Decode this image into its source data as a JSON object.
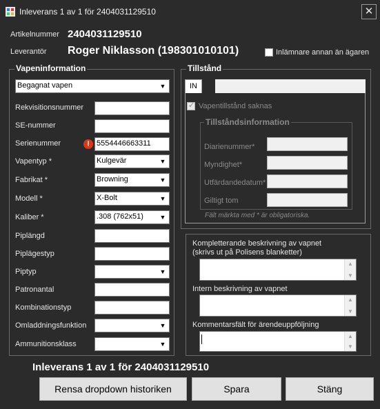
{
  "window": {
    "title": "Inleverans 1 av 1 för 2404031129510",
    "close_glyph": "✕"
  },
  "header": {
    "artikelnummer_label": "Artikelnummer",
    "artikelnummer_value": "2404031129510",
    "leverantor_label": "Leverantör",
    "leverantor_value": "Roger Niklasson (198301010101)",
    "annan_agare_label": "Inlämnare annan än ägaren",
    "annan_agare_checked": false
  },
  "vapeninfo": {
    "title": "Vapeninformation",
    "condition": "Begagnat vapen",
    "fields": [
      {
        "label": "Rekvisitionsnummer",
        "value": "",
        "type": "text"
      },
      {
        "label": "SE-nummer",
        "value": "",
        "type": "text"
      },
      {
        "label": "Serienummer",
        "value": "5554446663311",
        "type": "text",
        "warning": true
      },
      {
        "label": "Vapentyp *",
        "value": "Kulgevär",
        "type": "dropdown"
      },
      {
        "label": "Fabrikat *",
        "value": "Browning",
        "type": "dropdown"
      },
      {
        "label": "Modell *",
        "value": "X-Bolt",
        "type": "dropdown"
      },
      {
        "label": "Kaliber *",
        "value": ".308 (762x51)",
        "type": "dropdown"
      },
      {
        "label": "Piplängd",
        "value": "",
        "type": "text"
      },
      {
        "label": "Piplägestyp",
        "value": "",
        "type": "text"
      },
      {
        "label": "Piptyp",
        "value": "",
        "type": "dropdown"
      },
      {
        "label": "Patronantal",
        "value": "",
        "type": "text"
      },
      {
        "label": "Kombinationstyp",
        "value": "",
        "type": "text"
      },
      {
        "label": "Omladdningsfunktion",
        "value": "",
        "type": "dropdown"
      },
      {
        "label": "Ammunitionsklass",
        "value": "",
        "type": "dropdown"
      }
    ]
  },
  "tillstand": {
    "title": "Tillstånd",
    "tab": "IN",
    "saknas_label": "Vapentillstånd saknas",
    "saknas_checked": true,
    "info_title": "Tillståndsinformation",
    "fields": [
      {
        "label": "Diarienummer*",
        "value": ""
      },
      {
        "label": "Myndighet*",
        "value": ""
      },
      {
        "label": "Utfärdandedatum*",
        "value": ""
      },
      {
        "label": "Giltigt tom",
        "value": ""
      }
    ],
    "note": "Fält märkta med * är obligatoriska."
  },
  "descriptions": {
    "kompletterande_label": "Kompletterande beskrivning av vapnet\n(skrivs ut på Polisens blanketter)",
    "kompletterande_line1": "Kompletterande beskrivning av vapnet",
    "kompletterande_line2": "(skrivs ut på Polisens blanketter)",
    "intern_label": "Intern beskrivning av vapnet",
    "kommentar_label": "Kommentarsfält för ärendeuppföljning"
  },
  "footer": {
    "status": "Inleverans 1 av 1 för 2404031129510",
    "rensa_label": "Rensa dropdown historiken",
    "spara_label": "Spara",
    "stang_label": "Stäng"
  },
  "colors": {
    "background": "#2b2b2b",
    "field": "#ffffff",
    "warning": "#d8381b",
    "button": "#e1e1e1"
  }
}
